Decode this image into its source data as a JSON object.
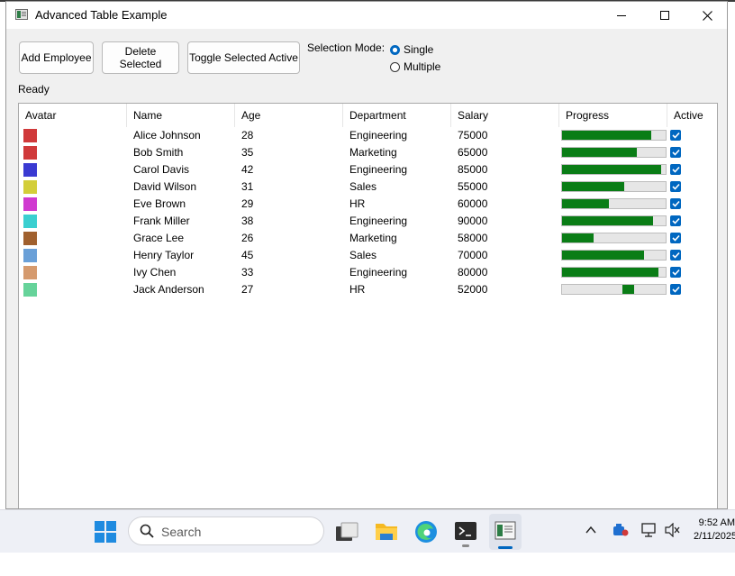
{
  "window": {
    "title": "Advanced Table Example"
  },
  "toolbar": {
    "add_label": "Add Employee",
    "delete_label": "Delete Selected",
    "toggle_label": "Toggle Selected Active",
    "selection_mode_label": "Selection Mode:",
    "mode_options": [
      "Single",
      "Multiple"
    ],
    "selected_mode": "Single"
  },
  "status_text": "Ready",
  "table": {
    "columns": [
      "Avatar",
      "Name",
      "Age",
      "Department",
      "Salary",
      "Progress",
      "Active"
    ],
    "rows": [
      {
        "avatar_color": "#d0393a",
        "name": "Alice Johnson",
        "age": "28",
        "department": "Engineering",
        "salary": "75000",
        "progress": 0.86,
        "active": true
      },
      {
        "avatar_color": "#d0393a",
        "name": "Bob Smith",
        "age": "35",
        "department": "Marketing",
        "salary": "65000",
        "progress": 0.72,
        "active": true
      },
      {
        "avatar_color": "#3a3ad2",
        "name": "Carol Davis",
        "age": "42",
        "department": "Engineering",
        "salary": "85000",
        "progress": 0.96,
        "active": true
      },
      {
        "avatar_color": "#d3ce3a",
        "name": "David Wilson",
        "age": "31",
        "department": "Sales",
        "salary": "55000",
        "progress": 0.6,
        "active": true
      },
      {
        "avatar_color": "#d03ad0",
        "name": "Eve Brown",
        "age": "29",
        "department": "HR",
        "salary": "60000",
        "progress": 0.45,
        "active": true
      },
      {
        "avatar_color": "#3acfd0",
        "name": "Frank Miller",
        "age": "38",
        "department": "Engineering",
        "salary": "90000",
        "progress": 0.88,
        "active": true
      },
      {
        "avatar_color": "#a0602e",
        "name": "Grace Lee",
        "age": "26",
        "department": "Marketing",
        "salary": "58000",
        "progress": 0.3,
        "active": true
      },
      {
        "avatar_color": "#6aa0d8",
        "name": "Henry Taylor",
        "age": "45",
        "department": "Sales",
        "salary": "70000",
        "progress": 0.79,
        "active": true
      },
      {
        "avatar_color": "#d59a6e",
        "name": "Ivy Chen",
        "age": "33",
        "department": "Engineering",
        "salary": "80000",
        "progress": 0.93,
        "active": true
      },
      {
        "avatar_color": "#66d39a",
        "name": "Jack Anderson",
        "age": "27",
        "department": "HR",
        "salary": "52000",
        "progress": 0.12,
        "progress_offset": 0.58,
        "active": true
      }
    ]
  },
  "taskbar": {
    "search_placeholder": "Search",
    "clock_time": "9:52 AM",
    "clock_date": "2/11/2025"
  },
  "colors": {
    "accent": "#0067c0",
    "progress_fill": "#0a7d16"
  }
}
